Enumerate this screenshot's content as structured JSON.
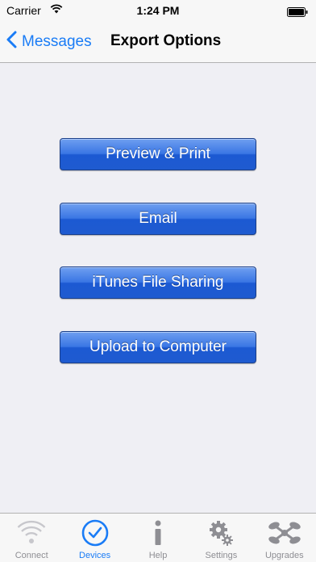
{
  "status_bar": {
    "carrier": "Carrier",
    "time": "1:24 PM",
    "wifi_icon": "wifi-icon",
    "battery_icon": "battery-icon"
  },
  "nav": {
    "back_label": "Messages",
    "title": "Export Options",
    "back_icon": "chevron-left-icon"
  },
  "buttons": [
    {
      "label": "Preview & Print"
    },
    {
      "label": "Email"
    },
    {
      "label": "iTunes File Sharing"
    },
    {
      "label": "Upload to Computer"
    }
  ],
  "tabs": [
    {
      "label": "Connect",
      "icon": "wifi-icon",
      "active": false
    },
    {
      "label": "Devices",
      "icon": "checkmark-circle-icon",
      "active": true
    },
    {
      "label": "Help",
      "icon": "info-icon",
      "active": false
    },
    {
      "label": "Settings",
      "icon": "gears-icon",
      "active": false
    },
    {
      "label": "Upgrades",
      "icon": "satellite-icon",
      "active": false
    }
  ],
  "colors": {
    "accent": "#1a7cf6",
    "button_blue": "#2a66d8",
    "background": "#efeff4",
    "inactive_tab": "#8e8e93"
  }
}
